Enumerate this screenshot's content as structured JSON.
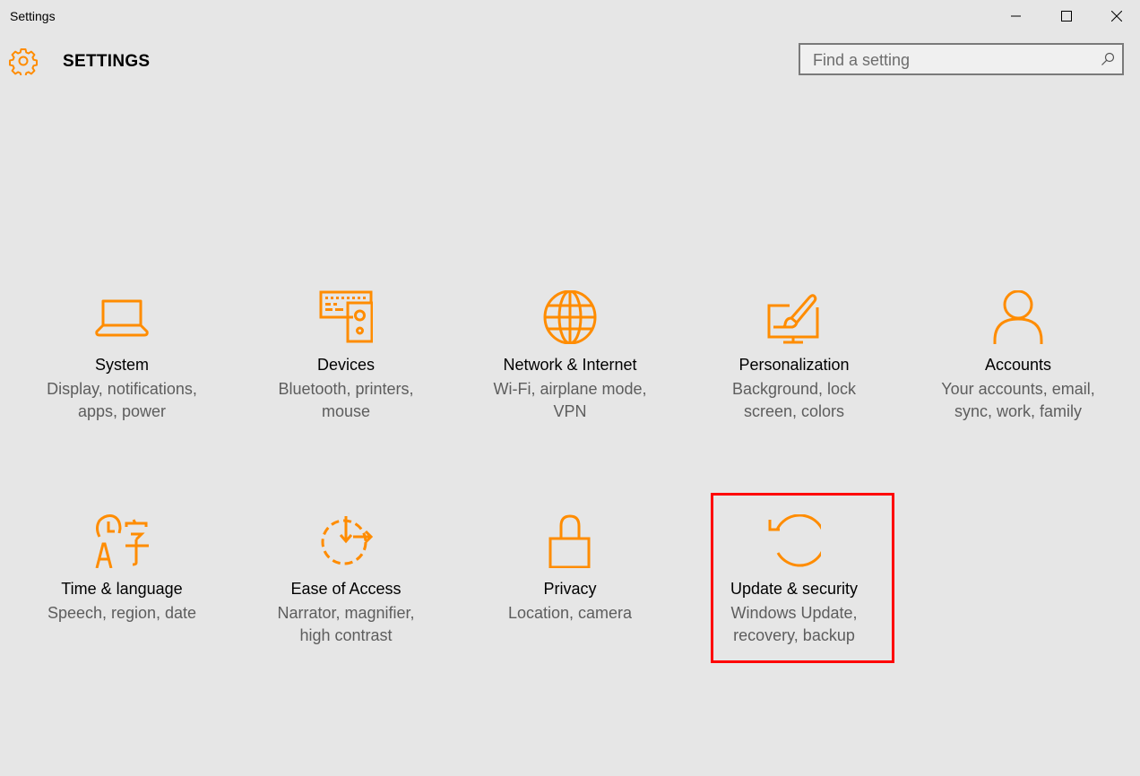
{
  "window": {
    "title": "Settings",
    "controls": {
      "minimize": "minimize",
      "maximize": "maximize",
      "close": "close"
    }
  },
  "header": {
    "title": "SETTINGS",
    "icon": "gear-icon"
  },
  "search": {
    "placeholder": "Find a setting",
    "value": "",
    "icon": "search-icon"
  },
  "accent_color": "#ff8c00",
  "highlight_color": "#ff0000",
  "tiles": [
    {
      "title": "System",
      "desc_line1": "Display, notifications,",
      "desc_line2": "apps, power",
      "icon": "laptop-icon"
    },
    {
      "title": "Devices",
      "desc_line1": "Bluetooth, printers,",
      "desc_line2": "mouse",
      "icon": "devices-icon"
    },
    {
      "title": "Network & Internet",
      "desc_line1": "Wi-Fi, airplane mode,",
      "desc_line2": "VPN",
      "icon": "globe-icon"
    },
    {
      "title": "Personalization",
      "desc_line1": "Background, lock",
      "desc_line2": "screen, colors",
      "icon": "paintbrush-monitor-icon"
    },
    {
      "title": "Accounts",
      "desc_line1": "Your accounts, email,",
      "desc_line2": "sync, work, family",
      "icon": "person-icon"
    },
    {
      "title": "Time & language",
      "desc_line1": "Speech, region, date",
      "desc_line2": "",
      "icon": "time-language-icon"
    },
    {
      "title": "Ease of Access",
      "desc_line1": "Narrator, magnifier,",
      "desc_line2": "high contrast",
      "icon": "ease-of-access-icon"
    },
    {
      "title": "Privacy",
      "desc_line1": "Location, camera",
      "desc_line2": "",
      "icon": "lock-icon"
    },
    {
      "title": "Update & security",
      "desc_line1": "Windows Update,",
      "desc_line2": "recovery, backup",
      "icon": "update-icon",
      "highlighted": true
    }
  ]
}
